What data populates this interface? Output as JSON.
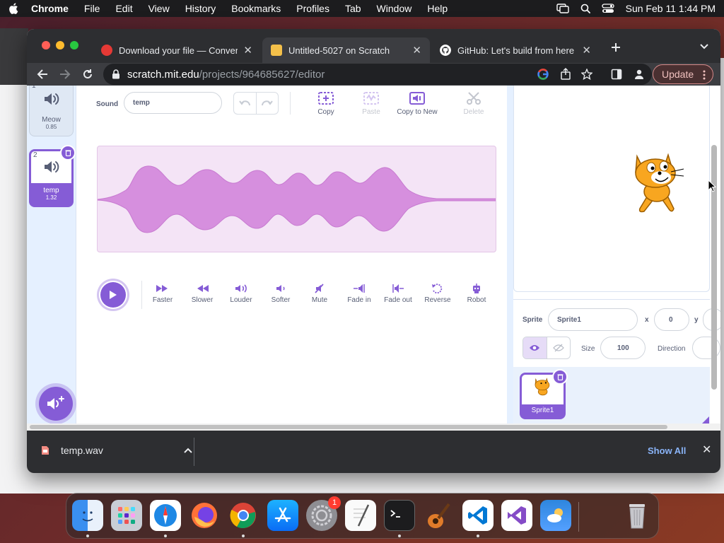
{
  "menubar": {
    "app": "Chrome",
    "items": [
      "File",
      "Edit",
      "View",
      "History",
      "Bookmarks",
      "Profiles",
      "Tab",
      "Window",
      "Help"
    ],
    "clock": "Sun Feb 11  1:44 PM"
  },
  "browser": {
    "tabs": [
      {
        "title": "Download your file — Convertio"
      },
      {
        "title": "Untitled-5027 on Scratch"
      },
      {
        "title": "GitHub: Let's build from here"
      }
    ],
    "url_host": "scratch.mit.edu",
    "url_path": "/projects/964685627/editor",
    "update_label": "Update"
  },
  "sounds": [
    {
      "number": "1",
      "name": "Meow",
      "duration": "0.85"
    },
    {
      "number": "2",
      "name": "temp",
      "duration": "1.32"
    }
  ],
  "editor": {
    "sound_label": "Sound",
    "sound_name": "temp",
    "tools": [
      "Copy",
      "Paste",
      "Copy to New",
      "Delete"
    ],
    "effects": [
      "Faster",
      "Slower",
      "Louder",
      "Softer",
      "Mute",
      "Fade in",
      "Fade out",
      "Reverse",
      "Robot"
    ]
  },
  "sprite_info": {
    "sprite_label": "Sprite",
    "sprite_name": "Sprite1",
    "x_label": "x",
    "x_value": "0",
    "y_label": "y",
    "size_label": "Size",
    "size_value": "100",
    "direction_label": "Direction"
  },
  "sprites": [
    {
      "name": "Sprite1"
    }
  ],
  "downloads": {
    "file": "temp.wav",
    "show_all": "Show All"
  },
  "dock": {
    "apps": [
      "finder-icon",
      "launchpad-icon",
      "safari-icon",
      "firefox-icon",
      "chrome-icon",
      "app-store-icon",
      "system-settings-icon",
      "textedit-icon",
      "terminal-icon",
      "garageband-icon",
      "vscode-icon",
      "visual-studio-icon",
      "weather-icon",
      "trash-icon"
    ],
    "settings_badge": "1"
  },
  "colors": {
    "scratch_purple": "#855cd6",
    "wave_fill": "#d68fde",
    "chrome_dark": "#2d2e31"
  }
}
